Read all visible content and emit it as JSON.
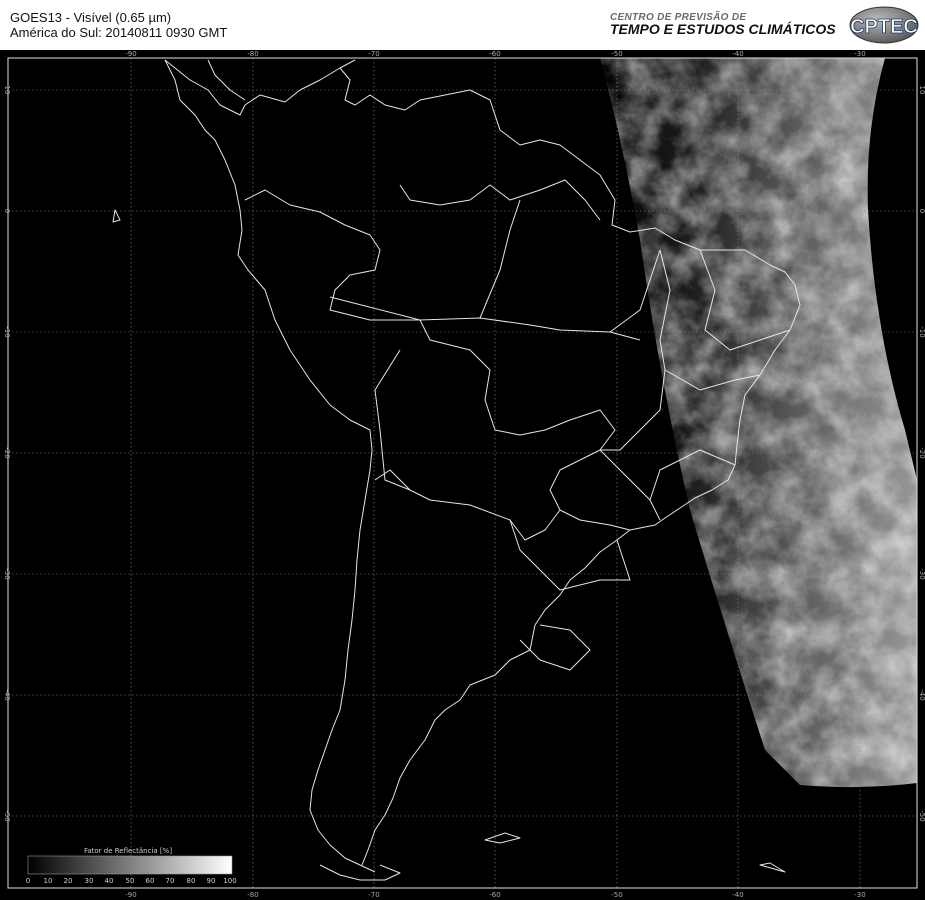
{
  "header": {
    "title_line1": "GOES13 - Visível (0.65 µm)",
    "title_line2": "América do Sul: 20140811 0930 GMT",
    "org_line1": "CENTRO DE PREVISÃO DE",
    "org_line2": "TEMPO E ESTUDOS CLIMÁTICOS",
    "logo_text": "CPTEC"
  },
  "map": {
    "longitude_labels": [
      "-90",
      "-80",
      "-70",
      "-60",
      "-50",
      "-40",
      "-30"
    ],
    "latitude_labels": [
      "10",
      "0",
      "-10",
      "-20",
      "-30",
      "-40",
      "-50"
    ],
    "background_color": "#000000",
    "border_color": "#e0e0e0",
    "grid_color": "#8a8a8a"
  },
  "legend": {
    "title": "Fator de Reflectância [%]",
    "ticks": [
      "0",
      "10",
      "20",
      "30",
      "40",
      "50",
      "60",
      "70",
      "80",
      "90",
      "100"
    ]
  }
}
